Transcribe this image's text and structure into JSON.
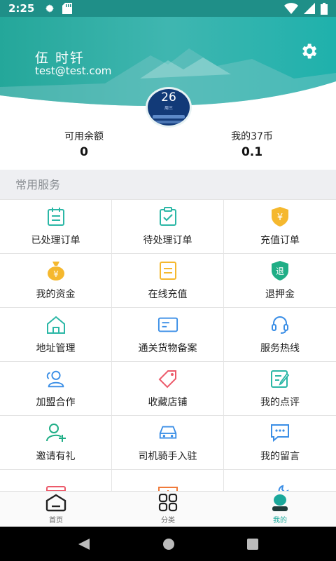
{
  "status_bar": {
    "time": "2:25"
  },
  "profile": {
    "name": "伍 时钎",
    "email": "test@test.com"
  },
  "avatar": {
    "day": "26",
    "week": "周三"
  },
  "balances": [
    {
      "label": "可用余额",
      "value": "0"
    },
    {
      "label": "我的37币",
      "value": "0.1"
    }
  ],
  "section": {
    "title": "常用服务"
  },
  "services": [
    {
      "label": "已处理订单",
      "icon": "calendar-list-icon"
    },
    {
      "label": "待处理订单",
      "icon": "clipboard-check-icon"
    },
    {
      "label": "充值订单",
      "icon": "yen-shield-icon"
    },
    {
      "label": "我的资金",
      "icon": "money-bag-icon"
    },
    {
      "label": "在线充值",
      "icon": "document-icon"
    },
    {
      "label": "退押金",
      "icon": "refund-shield-icon"
    },
    {
      "label": "地址管理",
      "icon": "home-icon"
    },
    {
      "label": "通关货物备案",
      "icon": "card-icon"
    },
    {
      "label": "服务热线",
      "icon": "headset-icon"
    },
    {
      "label": "加盟合作",
      "icon": "users-icon"
    },
    {
      "label": "收藏店铺",
      "icon": "tag-icon"
    },
    {
      "label": "我的点评",
      "icon": "edit-note-icon"
    },
    {
      "label": "邀请有礼",
      "icon": "add-user-icon"
    },
    {
      "label": "司机骑手入驻",
      "icon": "car-icon"
    },
    {
      "label": "我的留言",
      "icon": "message-icon"
    },
    {
      "label": "",
      "icon": "mailbox-icon"
    },
    {
      "label": "",
      "icon": "ticket-icon"
    },
    {
      "label": "",
      "icon": "wrench-icon"
    }
  ],
  "nav": [
    {
      "label": "首页",
      "icon": "home-tab-icon"
    },
    {
      "label": "分类",
      "icon": "grid-icon"
    },
    {
      "label": "我的",
      "icon": "profile-icon"
    }
  ],
  "colors": {
    "teal": "#1aa89b",
    "blue": "#3a8ee6",
    "yellow": "#f5b82e",
    "green": "#1fae86"
  }
}
